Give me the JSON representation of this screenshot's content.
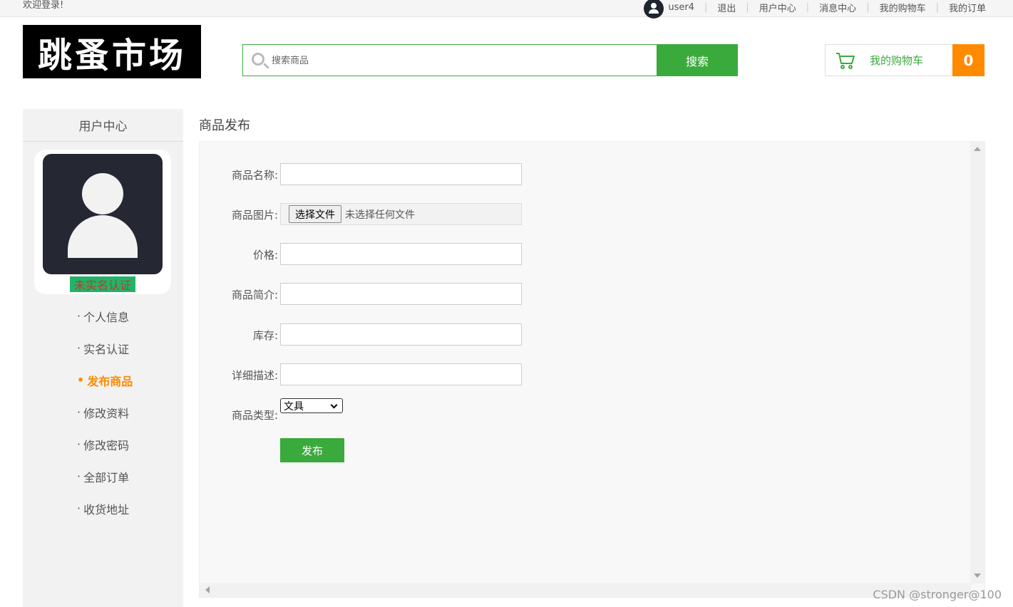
{
  "topbar": {
    "welcome": "欢迎登录!",
    "username": "user4",
    "links": [
      "退出",
      "用户中心",
      "消息中心",
      "我的购物车",
      "我的订单"
    ]
  },
  "header": {
    "logo_text": "跳蚤市场",
    "search": {
      "placeholder": "搜索商品",
      "button": "搜索"
    },
    "cart": {
      "label": "我的购物车",
      "count": "0"
    }
  },
  "sidebar": {
    "title": "用户中心",
    "verify_status": "未实名认证",
    "items": [
      {
        "label": "个人信息",
        "active": false
      },
      {
        "label": "实名认证",
        "active": false
      },
      {
        "label": "发布商品",
        "active": true
      },
      {
        "label": "修改资料",
        "active": false
      },
      {
        "label": "修改密码",
        "active": false
      },
      {
        "label": "全部订单",
        "active": false
      },
      {
        "label": "收货地址",
        "active": false
      }
    ]
  },
  "main": {
    "title": "商品发布",
    "form": {
      "name_label": "商品名称:",
      "image_label": "商品图片:",
      "file_button": "选择文件",
      "file_status": "未选择任何文件",
      "price_label": "价格:",
      "intro_label": "商品简介:",
      "stock_label": "库存:",
      "detail_label": "详细描述:",
      "type_label": "商品类型:",
      "type_selected": "文具",
      "submit": "发布"
    }
  },
  "watermark": "CSDN @stronger@100",
  "colors": {
    "brand_green": "#3aaa3c",
    "accent_orange": "#ff8a00",
    "username_red": "#e8541a"
  }
}
